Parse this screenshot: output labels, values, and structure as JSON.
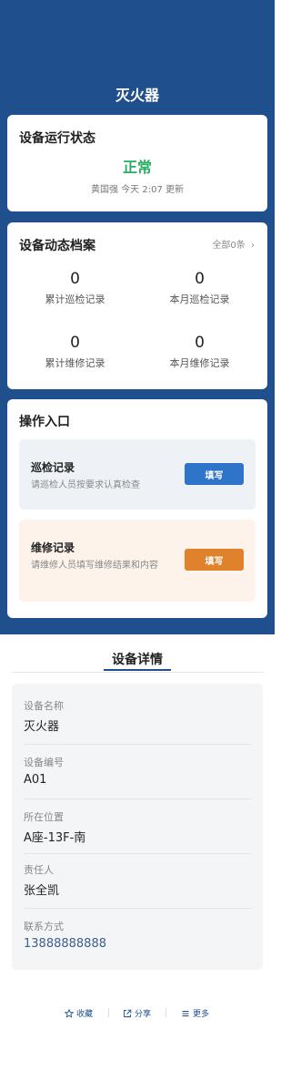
{
  "header": {
    "title": "灭火器"
  },
  "status_card": {
    "title": "设备运行状态",
    "status": "正常",
    "meta": "黄国强 今天 2:07 更新",
    "status_color": "#27ae60"
  },
  "archive_card": {
    "title": "设备动态档案",
    "all_link": "全部0条",
    "stats": [
      {
        "value": "0",
        "label": "累计巡检记录"
      },
      {
        "value": "0",
        "label": "本月巡检记录"
      },
      {
        "value": "0",
        "label": "累计维修记录"
      },
      {
        "value": "0",
        "label": "本月维修记录"
      }
    ]
  },
  "ops_card": {
    "title": "操作入口",
    "inspect": {
      "title": "巡检记录",
      "desc": "请巡检人员按要求认真检查",
      "button": "填写",
      "button_color": "#2e74c8",
      "bg": "#eef2f7"
    },
    "repair": {
      "title": "维修记录",
      "desc": "请维修人员填写维修结果和内容",
      "button": "填写",
      "button_color": "#e0822c",
      "bg": "#fdf3ea"
    }
  },
  "details": {
    "tab": "设备详情",
    "fields": [
      {
        "label": "设备名称",
        "value": "灭火器"
      },
      {
        "label": "设备编号",
        "value": "A01"
      },
      {
        "label": "所在位置",
        "value": "A座-13F-南"
      },
      {
        "label": "责任人",
        "value": "张全凯"
      },
      {
        "label": "联系方式",
        "value": "13888888888"
      }
    ]
  },
  "footer": {
    "favorite": {
      "label": "收藏",
      "icon": "star-icon"
    },
    "share": {
      "label": "分享",
      "icon": "share-icon"
    },
    "more": {
      "label": "更多",
      "icon": "menu-icon"
    }
  },
  "colors": {
    "brand": "#1f4f8d",
    "phone_link": "#3b5f8a"
  }
}
